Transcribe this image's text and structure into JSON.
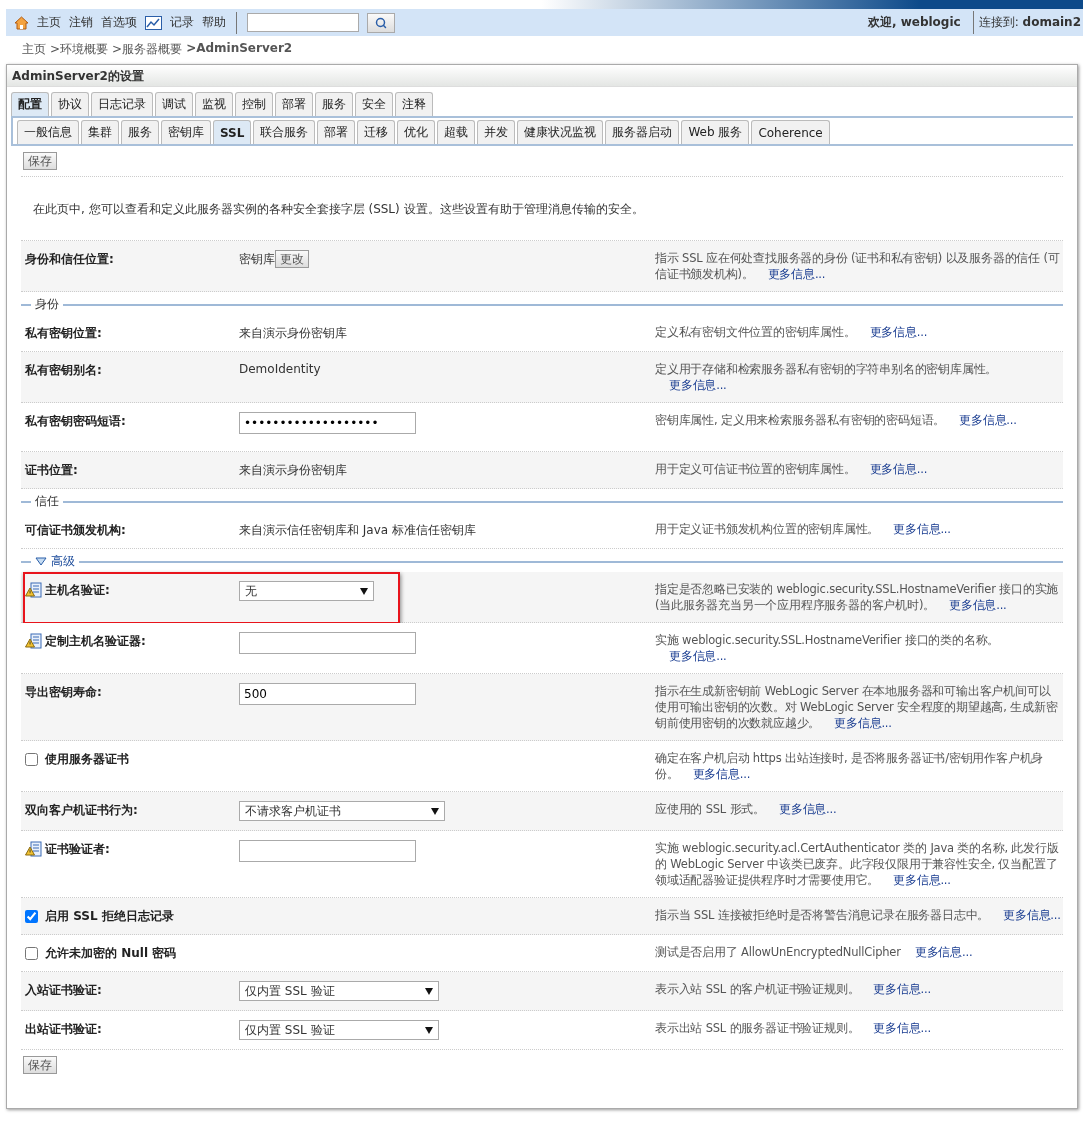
{
  "toolbar": {
    "links": [
      {
        "kind": "home",
        "label": "主页"
      },
      {
        "kind": "plain",
        "label": "注销"
      },
      {
        "kind": "plain",
        "label": "首选项"
      },
      {
        "kind": "chart",
        "label": "记录"
      },
      {
        "kind": "plain",
        "label": "帮助"
      }
    ],
    "welcome": "欢迎, weblogic",
    "connection": "连接到: **domain2**"
  },
  "breadcrumb": [
    {
      "label": "主页",
      "current": false
    },
    {
      "label": ">环境概要",
      "current": false
    },
    {
      "label": ">服务器概要",
      "current": false
    },
    {
      "label": ">AdminServer2",
      "current": true
    }
  ],
  "panel": {
    "title": "AdminServer2的设置",
    "tabs": [
      {
        "label": "配置",
        "selected": true
      },
      {
        "label": "协议",
        "selected": false
      },
      {
        "label": "日志记录",
        "selected": false
      },
      {
        "label": "调试",
        "selected": false
      },
      {
        "label": "监视",
        "selected": false
      },
      {
        "label": "控制",
        "selected": false
      },
      {
        "label": "部署",
        "selected": false
      },
      {
        "label": "服务",
        "selected": false
      },
      {
        "label": "安全",
        "selected": false
      },
      {
        "label": "注释",
        "selected": false
      }
    ],
    "subtabs": [
      {
        "label": "一般信息",
        "selected": false
      },
      {
        "label": "集群",
        "selected": false
      },
      {
        "label": "服务",
        "selected": false
      },
      {
        "label": "密钥库",
        "selected": false
      },
      {
        "label": "SSL",
        "selected": true
      },
      {
        "label": "联合服务",
        "selected": false
      },
      {
        "label": "部署",
        "selected": false
      },
      {
        "label": "迁移",
        "selected": false
      },
      {
        "label": "优化",
        "selected": false
      },
      {
        "label": "超载",
        "selected": false
      },
      {
        "label": "并发",
        "selected": false
      },
      {
        "label": "健康状况监视",
        "selected": false
      },
      {
        "label": "服务器启动",
        "selected": false
      },
      {
        "label": "Web 服务",
        "selected": false
      },
      {
        "label": "Coherence",
        "selected": false
      }
    ],
    "save_button": "保存",
    "intro": "在此页中, 您可以查看和定义此服务器实例的各种安全套接字层 (SSL) 设置。这些设置有助于管理消息传输的安全。",
    "sections": [
      {
        "rows": [
          {
            "kind": "keystore",
            "label": "身份和信任位置:",
            "value": "密钥库",
            "button": "更改",
            "description": "指示 SSL 应在何处查找服务器的身份 (证书和私有密钥) 以及服务器的信任 (可信证书颁发机构)。",
            "link": "更多信息..."
          }
        ]
      },
      {
        "heading": "身份",
        "rows": [
          {
            "kind": "text",
            "label": "私有密钥位置:",
            "value": "来自演示身份密钥库",
            "description": "定义私有密钥文件位置的密钥库属性。",
            "link": "更多信息..."
          },
          {
            "kind": "text",
            "label": "私有密钥别名:",
            "value": "DemoIdentity",
            "description": "定义用于存储和检索服务器私有密钥的字符串别名的密钥库属性。",
            "link": "更多信息..."
          },
          {
            "kind": "input",
            "label": "私有密钥密码短语:",
            "value": "•••••••••••••••••••",
            "description": "密钥库属性, 定义用来检索服务器私有密钥的密码短语。",
            "link": "更多信息..."
          },
          {
            "kind": "text",
            "label": "证书位置:",
            "value": "来自演示身份密钥库",
            "description": "用于定义可信证书位置的密钥库属性。",
            "link": "更多信息..."
          }
        ]
      },
      {
        "heading": "信任",
        "rows": [
          {
            "kind": "text",
            "label": "可信证书颁发机构:",
            "value": "来自演示信任密钥库和 Java 标准信任密钥库",
            "description": "用于定义证书颁发机构位置的密钥库属性。",
            "link": "更多信息..."
          }
        ]
      },
      {
        "heading": "高级",
        "expanded": true,
        "rows": [
          {
            "kind": "select",
            "label": "主机名验证:",
            "warning": true,
            "highlighted": true,
            "value": "无",
            "description": "指定是否忽略已安装的 weblogic.security.SSL.HostnameVerifier 接口的实施 (当此服务器充当另一个应用程序服务器的客户机时)。",
            "link": "更多信息..."
          },
          {
            "kind": "input",
            "label": "定制主机名验证器:",
            "warning": true,
            "highlighted": false,
            "description": "实施 weblogic.security.SSL.HostnameVerifier 接口的类的名称。",
            "link": "更多信息..."
          },
          {
            "kind": "input",
            "label": "导出密钥寿命:",
            "warning": false,
            "highlighted": false,
            "value": "500",
            "description": "指示在生成新密钥前 WebLogic Server 在本地服务器和可输出客户机间可以使用可输出密钥的次数。对 WebLogic Server 安全程度的期望越高, 生成新密钥前使用密钥的次数就应越少。",
            "link": "更多信息..."
          },
          {
            "kind": "checkbox",
            "label": "使用服务器证书",
            "checked": false,
            "highlighted": false,
            "description": "确定在客户机启动 https 出站连接时, 是否将服务器证书/密钥用作客户机身份。",
            "link": "更多信息..."
          },
          {
            "kind": "select",
            "label": "双向客户机证书行为:",
            "warning": false,
            "highlighted": false,
            "value": "不请求客户机证书",
            "description": "应使用的 SSL 形式。",
            "link": "更多信息..."
          },
          {
            "kind": "input",
            "label": "证书验证者:",
            "warning": true,
            "highlighted": false,
            "description": "实施 weblogic.security.acl.CertAuthenticator 类的 Java 类的名称, 此发行版的 WebLogic Server 中该类已废弃。此字段仅限用于兼容性安全, 仅当配置了领域适配器验证提供程序时才需要使用它。",
            "link": "更多信息..."
          },
          {
            "kind": "checkbox",
            "label": "启用 SSL 拒绝日志记录",
            "checked": true,
            "highlighted": false,
            "description": "指示当 SSL 连接被拒绝时是否将警告消息记录在服务器日志中。",
            "link": "更多信息..."
          },
          {
            "kind": "checkbox",
            "label": "允许未加密的 Null 密码",
            "checked": false,
            "highlighted": false,
            "description": "测试是否启用了 AllowUnEncryptedNullCipher",
            "link": "更多信息..."
          },
          {
            "kind": "select",
            "label": "入站证书验证:",
            "warning": false,
            "highlighted": false,
            "value": "仅内置 SSL 验证",
            "description": "表示入站 SSL 的客户机证书验证规则。",
            "link": "更多信息..."
          },
          {
            "kind": "select",
            "label": "出站证书验证:",
            "warning": false,
            "highlighted": false,
            "value": "仅内置 SSL 验证",
            "description": "表示出站 SSL 的服务器证书验证规则。",
            "link": "更多信息..."
          }
        ]
      }
    ],
    "bottom_save_button": "保存"
  }
}
